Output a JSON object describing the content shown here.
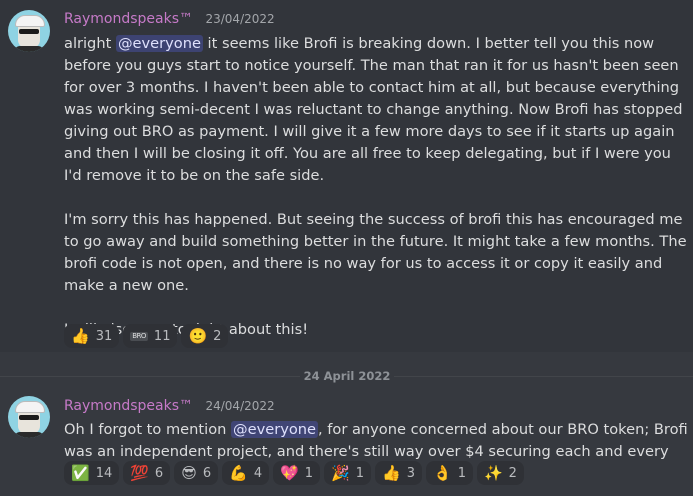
{
  "colors": {
    "background": "#36393f",
    "first_message_bg": "#32353b",
    "username": "#c67ac8",
    "mention_bg": "#5865f2",
    "text": "#dcddde"
  },
  "messages": [
    {
      "author": "Raymondspeaks™",
      "timestamp": "23/04/2022",
      "avatar_icon": "avatar-icon",
      "paragraphs": [
        {
          "before": "alright ",
          "mention": "@everyone",
          "after": " it seems like Brofi is breaking down. I better tell you this now before you guys start to notice yourself. The man that ran it for us hasn't been seen for over 3 months. I haven't been able to contact him at all, but because everything was working semi-decent I was reluctant to change anything. Now Brofi has stopped giving out BRO as payment. I will give it a few more days to see if it starts up again and then I will be closing it off. You are all free to keep delegating, but if I were you I'd remove it to be on the safe side."
        },
        {
          "before": "I'm sorry this has happened. But seeing the success of brofi this has encouraged me to go away and build something better in the future. It might take a few months. The brofi code is not open, and there is no way for us to access it or copy it easily and make a new one.",
          "mention": "",
          "after": ""
        },
        {
          "before": "I will also post tonight about this!",
          "mention": "",
          "after": ""
        }
      ],
      "reactions": [
        {
          "emoji": "👍",
          "icon": "thumbs-up-icon",
          "count": "31"
        },
        {
          "emoji": "BRO",
          "icon": "bro-custom-emoji-icon",
          "count": "11",
          "custom": true
        },
        {
          "emoji": "🙂",
          "icon": "slight-smile-icon",
          "count": "2"
        }
      ]
    },
    {
      "author": "Raymondspeaks™",
      "timestamp": "24/04/2022",
      "avatar_icon": "avatar-icon",
      "paragraphs": [
        {
          "before": "Oh I forgot to mention ",
          "mention": "@everyone",
          "after": ", for anyone concerned about our BRO token; Brofi was an independent project, and there's still way over $4 securing each and every BRO."
        }
      ],
      "reactions": [
        {
          "emoji": "✅",
          "icon": "white-check-mark-icon",
          "count": "14"
        },
        {
          "emoji": "💯",
          "icon": "hundred-points-icon",
          "count": "6"
        },
        {
          "emoji": "😎",
          "icon": "sunglasses-icon",
          "count": "6"
        },
        {
          "emoji": "💪",
          "icon": "muscle-icon",
          "count": "4"
        },
        {
          "emoji": "💖",
          "icon": "sparkling-heart-icon",
          "count": "1"
        },
        {
          "emoji": "🎉",
          "icon": "party-popper-icon",
          "count": "1"
        },
        {
          "emoji": "👍",
          "icon": "thumbs-up-icon",
          "count": "3"
        },
        {
          "emoji": "👌",
          "icon": "ok-hand-icon",
          "count": "1"
        },
        {
          "emoji": "✨",
          "icon": "sparkles-icon",
          "count": "2"
        }
      ]
    }
  ],
  "date_divider": "24 April 2022"
}
